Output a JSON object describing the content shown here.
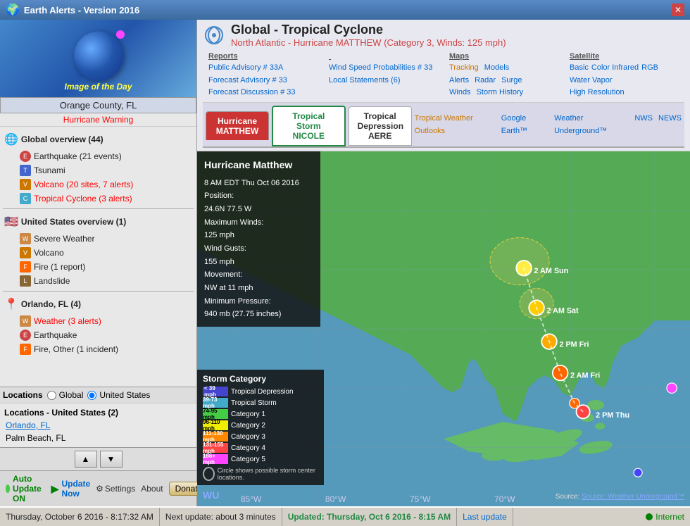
{
  "app": {
    "title": "Earth Alerts - Version 2016",
    "version": "2016"
  },
  "left_panel": {
    "image_of_day_label": "Image of the Day",
    "location": "Orange County, FL",
    "warning": "Hurricane Warning",
    "global_overview": {
      "header": "Global overview (44)",
      "items": [
        {
          "label": "Earthquake (21 events)",
          "type": "earthquake",
          "alert": false
        },
        {
          "label": "Tsunami",
          "type": "tsunami",
          "alert": false
        },
        {
          "label": "Volcano (20 sites, 7 alerts)",
          "type": "volcano",
          "alert": true
        },
        {
          "label": "Tropical Cyclone (3 alerts)",
          "type": "cyclone",
          "alert": true
        }
      ]
    },
    "us_overview": {
      "header": "United States overview (1)",
      "items": [
        {
          "label": "Severe Weather",
          "type": "weather",
          "alert": false
        },
        {
          "label": "Volcano",
          "type": "volcano",
          "alert": false
        },
        {
          "label": "Fire (1 report)",
          "type": "fire",
          "alert": false
        },
        {
          "label": "Landslide",
          "type": "landslide",
          "alert": false
        }
      ]
    },
    "orlando_overview": {
      "header": "Orlando, FL (4)",
      "items": [
        {
          "label": "Weather (3 alerts)",
          "type": "weather",
          "alert": true
        },
        {
          "label": "Earthquake",
          "type": "earthquake",
          "alert": false
        },
        {
          "label": "Fire, Other (1 incident)",
          "type": "fire",
          "alert": false
        }
      ]
    },
    "locations_tabs": {
      "label": "Locations",
      "options": [
        "Global",
        "United States"
      ],
      "selected": "United States"
    },
    "locations_list": {
      "header": "Locations - United States (2)",
      "items": [
        {
          "label": "Orlando, FL",
          "active": true
        },
        {
          "label": "Palm Beach, FL",
          "active": false
        }
      ]
    },
    "buttons": {
      "up": "▲",
      "down": "▼"
    },
    "auto_update": "Auto Update ON",
    "update_now": "Update Now",
    "donate": "Donate",
    "settings": "Settings",
    "about": "About"
  },
  "right_panel": {
    "header": {
      "main_title": "Global - Tropical Cyclone",
      "subtitle": "North Atlantic - Hurricane MATTHEW (Category 3, Winds: 125 mph)"
    },
    "reports": {
      "label": "Reports",
      "links": [
        "Public Advisory # 33A",
        "Forecast Advisory # 33",
        "Forecast Discussion # 33"
      ],
      "links2": [
        "Wind Speed Probabilities # 33",
        "Local Statements (6)"
      ]
    },
    "maps": {
      "label": "Maps",
      "tracking": "Tracking",
      "models": "Models",
      "alerts": "Alerts",
      "radar": "Radar",
      "surge": "Surge",
      "winds": "Winds",
      "storm_history": "Storm History"
    },
    "satellite": {
      "label": "Satellite",
      "basic": "Basic",
      "color_infrared": "Color Infrared",
      "rgb": "RGB",
      "water_vapor": "Water Vapor",
      "high_resolution": "High Resolution"
    },
    "external_links": [
      "Tropical Weather Outlooks",
      "Google Earth™",
      "Weather Underground™",
      "NWS",
      "NEWS"
    ],
    "storms": [
      {
        "name": "Hurricane\nMATTHEW",
        "type": "hurricane",
        "active": true
      },
      {
        "name": "Tropical Storm\nNICOLE",
        "type": "tropical_storm",
        "active": false
      },
      {
        "name": "Tropical\nDepression\nAERE",
        "type": "depression",
        "active": false
      }
    ],
    "storm_info": {
      "title": "Hurricane Matthew",
      "time": "8 AM EDT Thu Oct 06 2016",
      "position_label": "Position:",
      "position": "24.6N 77.5 W",
      "max_winds_label": "Maximum Winds:",
      "max_winds": "125 mph",
      "wind_gusts_label": "Wind Gusts:",
      "wind_gusts": "155 mph",
      "movement_label": "Movement:",
      "movement": "NW at 11 mph",
      "min_pressure_label": "Minimum Pressure:",
      "min_pressure": "940 mb (27.75 inches)"
    },
    "category_legend": {
      "title": "Storm Category",
      "categories": [
        {
          "speed": "< 39 mph",
          "label": "Tropical Depression",
          "color": "#4444cc"
        },
        {
          "speed": "39-73 mph",
          "label": "Tropical Storm",
          "color": "#44aacc"
        },
        {
          "speed": "74-95 mph",
          "label": "Category 1",
          "color": "#44cc44"
        },
        {
          "speed": "96-110 mph",
          "label": "Category 2",
          "color": "#eeee00"
        },
        {
          "speed": "111-130 mph",
          "label": "Category 3",
          "color": "#ff8800"
        },
        {
          "speed": "131-155 mph",
          "label": "Category 4",
          "color": "#ff4444"
        },
        {
          "speed": "166+ mph",
          "label": "Category 5",
          "color": "#ff44ff"
        },
        {
          "speed": "",
          "label": "Circle shows possible storm center locations.",
          "color": "transparent",
          "is_circle": true
        }
      ]
    },
    "wu_logo": "WU",
    "source_credit": "Source: Weather Underground™"
  },
  "status_bar": {
    "datetime": "Thursday, October 6 2016 - 8:17:32 AM",
    "next_update": "Next update: about 3 minutes",
    "updated": "Updated: Thursday, Oct 6 2016 - 8:15 AM",
    "last_update": "Last update",
    "internet": "Internet"
  }
}
